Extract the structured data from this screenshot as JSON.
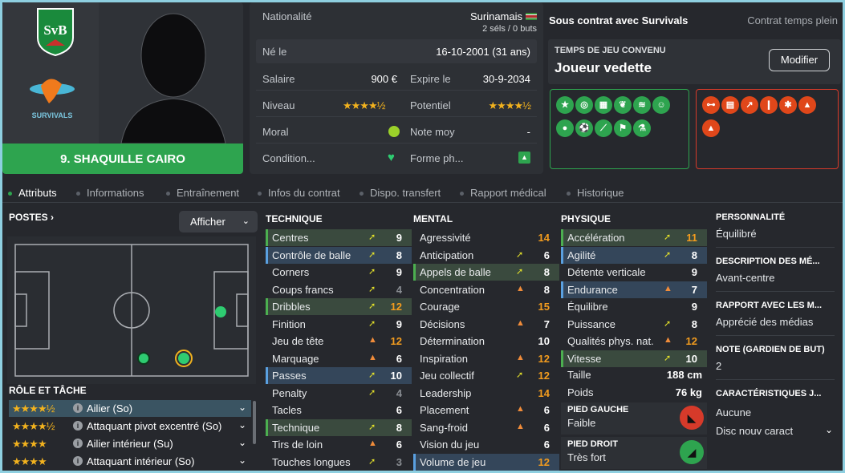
{
  "player": {
    "name": "9. SHAQUILLE CAIRO"
  },
  "info": {
    "nationality_label": "Nationalité",
    "nationality_value": "Surinamais",
    "caps": "2 séls / 0 buts",
    "born_label": "Né le",
    "born_value": "16-10-2001 (31 ans)",
    "salary_label": "Salaire",
    "salary_value": "900 €",
    "expires_label": "Expire le",
    "expires_value": "30-9-2034",
    "level_label": "Niveau",
    "level_stars": "★★★★½",
    "potential_label": "Potentiel",
    "potential_stars": "★★★★½",
    "morale_label": "Moral",
    "avg_label": "Note moy",
    "avg_value": "-",
    "condition_label": "Condition...",
    "form_label": "Forme ph..."
  },
  "contract": {
    "title": "Sous contrat avec Survivals",
    "type": "Contrat temps plein",
    "playtime_label": "TEMPS DE JEU CONVENU",
    "playtime_value": "Joueur vedette",
    "modify_button": "Modifier"
  },
  "tabs": [
    "Attributs",
    "Informations",
    "Entraînement",
    "Infos du contrat",
    "Dispo. transfert",
    "Rapport médical",
    "Historique"
  ],
  "positions": {
    "title": "POSTES ›",
    "show_button": "Afficher"
  },
  "roles": {
    "title": "RÔLE ET TÂCHE",
    "items": [
      {
        "stars": "★★★★½",
        "label": "Ailier (So)"
      },
      {
        "stars": "★★★★½",
        "label": "Attaquant pivot excentré (So)"
      },
      {
        "stars": "★★★★",
        "label": "Ailier intérieur (Su)"
      },
      {
        "stars": "★★★★",
        "label": "Attaquant intérieur (So)"
      }
    ]
  },
  "technique": {
    "title": "TECHNIQUE",
    "rows": [
      {
        "name": "Centres",
        "value": "9"
      },
      {
        "name": "Contrôle de balle",
        "value": "8"
      },
      {
        "name": "Corners",
        "value": "9"
      },
      {
        "name": "Coups francs",
        "value": "4"
      },
      {
        "name": "Dribbles",
        "value": "12"
      },
      {
        "name": "Finition",
        "value": "9"
      },
      {
        "name": "Jeu de tête",
        "value": "12"
      },
      {
        "name": "Marquage",
        "value": "6"
      },
      {
        "name": "Passes",
        "value": "10"
      },
      {
        "name": "Penalty",
        "value": "4"
      },
      {
        "name": "Tacles",
        "value": "6"
      },
      {
        "name": "Technique",
        "value": "8"
      },
      {
        "name": "Tirs de loin",
        "value": "6"
      },
      {
        "name": "Touches longues",
        "value": "3"
      }
    ]
  },
  "mental": {
    "title": "MENTAL",
    "rows": [
      {
        "name": "Agressivité",
        "value": "14"
      },
      {
        "name": "Anticipation",
        "value": "6"
      },
      {
        "name": "Appels de balle",
        "value": "8"
      },
      {
        "name": "Concentration",
        "value": "8"
      },
      {
        "name": "Courage",
        "value": "15"
      },
      {
        "name": "Décisions",
        "value": "7"
      },
      {
        "name": "Détermination",
        "value": "10"
      },
      {
        "name": "Inspiration",
        "value": "12"
      },
      {
        "name": "Jeu collectif",
        "value": "12"
      },
      {
        "name": "Leadership",
        "value": "14"
      },
      {
        "name": "Placement",
        "value": "6"
      },
      {
        "name": "Sang-froid",
        "value": "6"
      },
      {
        "name": "Vision du jeu",
        "value": "6"
      },
      {
        "name": "Volume de jeu",
        "value": "12"
      }
    ]
  },
  "physique": {
    "title": "PHYSIQUE",
    "rows": [
      {
        "name": "Accélération",
        "value": "11"
      },
      {
        "name": "Agilité",
        "value": "8"
      },
      {
        "name": "Détente verticale",
        "value": "9"
      },
      {
        "name": "Endurance",
        "value": "7"
      },
      {
        "name": "Équilibre",
        "value": "9"
      },
      {
        "name": "Puissance",
        "value": "8"
      },
      {
        "name": "Qualités phys. nat.",
        "value": "12"
      },
      {
        "name": "Vitesse",
        "value": "10"
      }
    ],
    "height_label": "Taille",
    "height_value": "188 cm",
    "weight_label": "Poids",
    "weight_value": "76 kg",
    "left_foot_label": "PIED GAUCHE",
    "left_foot_value": "Faible",
    "right_foot_label": "PIED DROIT",
    "right_foot_value": "Très fort"
  },
  "side": {
    "personality_label": "PERSONNALITÉ",
    "personality_value": "Équilibré",
    "description_label": "DESCRIPTION DES MÉ...",
    "description_value": "Avant-centre",
    "media_label": "RAPPORT AVEC LES M...",
    "media_value": "Apprécié des médias",
    "gk_label": "NOTE (GARDIEN DE BUT)",
    "gk_value": "2",
    "traits_label": "CARACTÉRISTIQUES J...",
    "traits_value": "Aucune",
    "traits_select": "Disc nouv caract"
  },
  "colors": {
    "accent": "#2ea44f",
    "negative": "#e0471a",
    "gold": "#f2b21e",
    "orange": "#f39c1e"
  }
}
